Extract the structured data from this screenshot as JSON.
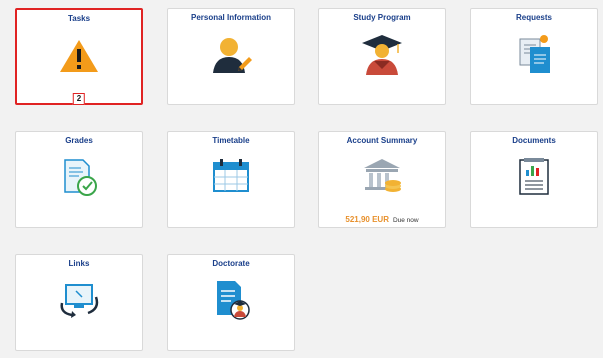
{
  "tiles": {
    "tasks": {
      "title": "Tasks",
      "icon": "warning-icon",
      "badge": "2"
    },
    "personal_information": {
      "title": "Personal Information",
      "icon": "user-edit-icon"
    },
    "study_program": {
      "title": "Study Program",
      "icon": "graduate-icon"
    },
    "requests": {
      "title": "Requests",
      "icon": "request-documents-icon"
    },
    "grades": {
      "title": "Grades",
      "icon": "grades-document-check-icon"
    },
    "timetable": {
      "title": "Timetable",
      "icon": "calendar-icon"
    },
    "account_summary": {
      "title": "Account Summary",
      "icon": "bank-coins-icon",
      "amount": "521,90 EUR",
      "due": "Due now"
    },
    "documents": {
      "title": "Documents",
      "icon": "report-chart-icon"
    },
    "links": {
      "title": "Links",
      "icon": "screen-link-icon"
    },
    "doctorate": {
      "title": "Doctorate",
      "icon": "document-doctorate-icon"
    }
  },
  "colors": {
    "title": "#1a3f8a",
    "selection": "#e02323",
    "warning": "#f39b1a",
    "amount": "#e8912d",
    "icon_blue": "#1f8ecf"
  }
}
